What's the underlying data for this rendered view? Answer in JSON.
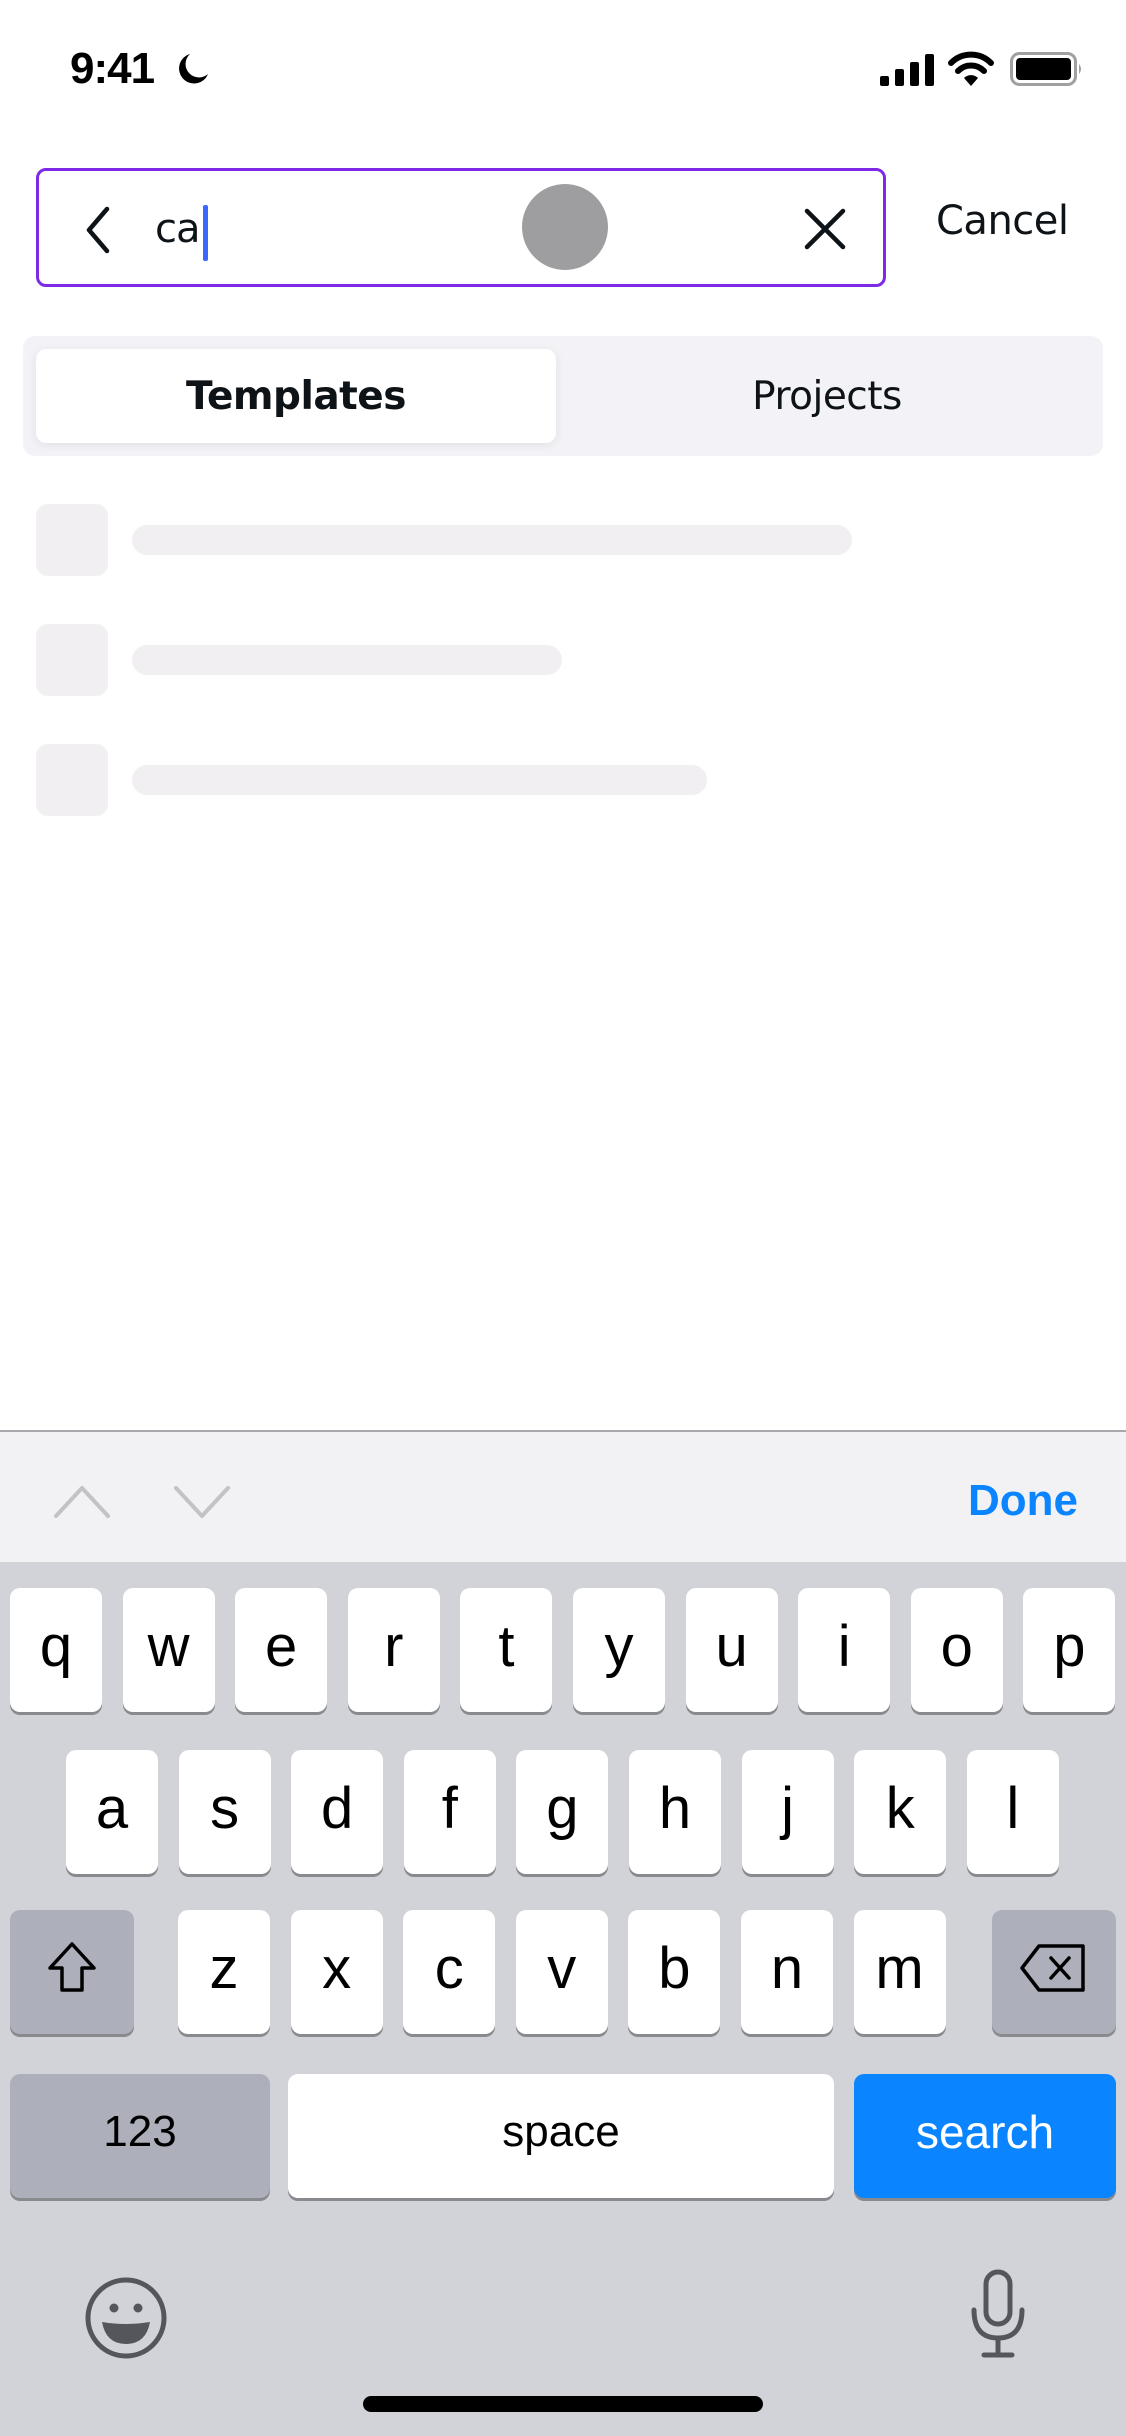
{
  "status_bar": {
    "time": "9:41",
    "icons": [
      "moon-icon",
      "cellular-signal-icon",
      "wifi-icon",
      "battery-icon"
    ]
  },
  "search": {
    "value": "ca",
    "placeholder": "",
    "back_icon": "chevron-left-icon",
    "clear_icon": "close-icon",
    "cancel_label": "Cancel",
    "accent_color": "#7d2ae8"
  },
  "tabs": [
    {
      "label": "Templates",
      "active": true
    },
    {
      "label": "Projects",
      "active": false
    }
  ],
  "skeleton_rows": [
    {
      "line_fraction": 0.72
    },
    {
      "line_fraction": 0.43
    },
    {
      "line_fraction": 0.575
    }
  ],
  "accessory": {
    "prev_icon": "chevron-up-icon",
    "next_icon": "chevron-down-icon",
    "done_label": "Done"
  },
  "keyboard": {
    "row1": [
      "q",
      "w",
      "e",
      "r",
      "t",
      "y",
      "u",
      "i",
      "o",
      "p"
    ],
    "row2": [
      "a",
      "s",
      "d",
      "f",
      "g",
      "h",
      "j",
      "k",
      "l"
    ],
    "row3": [
      "z",
      "x",
      "c",
      "v",
      "b",
      "n",
      "m"
    ],
    "shift_icon": "shift-icon",
    "delete_icon": "backspace-icon",
    "numbers_label": "123",
    "space_label": "space",
    "search_label": "search",
    "emoji_icon": "emoji-icon",
    "mic_icon": "microphone-icon"
  }
}
